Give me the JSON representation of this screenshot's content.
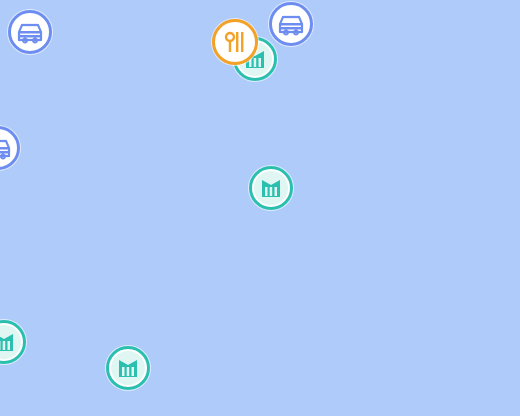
{
  "map": {
    "background": "#aecbfa",
    "colors": {
      "transit": "#6d8df0",
      "building": "#2bbfb0",
      "restaurant": "#f4a127"
    },
    "markers": [
      {
        "name": "transit-marker-1",
        "icon": "car-icon",
        "category": "transit"
      },
      {
        "name": "transit-marker-2",
        "icon": "car-icon",
        "category": "transit"
      },
      {
        "name": "transit-marker-3",
        "icon": "car-icon",
        "category": "transit"
      },
      {
        "name": "building-marker-1",
        "icon": "building-icon",
        "category": "building"
      },
      {
        "name": "building-marker-2",
        "icon": "building-icon",
        "category": "building"
      },
      {
        "name": "building-marker-3",
        "icon": "building-icon",
        "category": "building"
      },
      {
        "name": "building-marker-4",
        "icon": "building-icon",
        "category": "building"
      },
      {
        "name": "restaurant-marker-1",
        "icon": "fork-knife-icon",
        "category": "restaurant"
      }
    ]
  }
}
